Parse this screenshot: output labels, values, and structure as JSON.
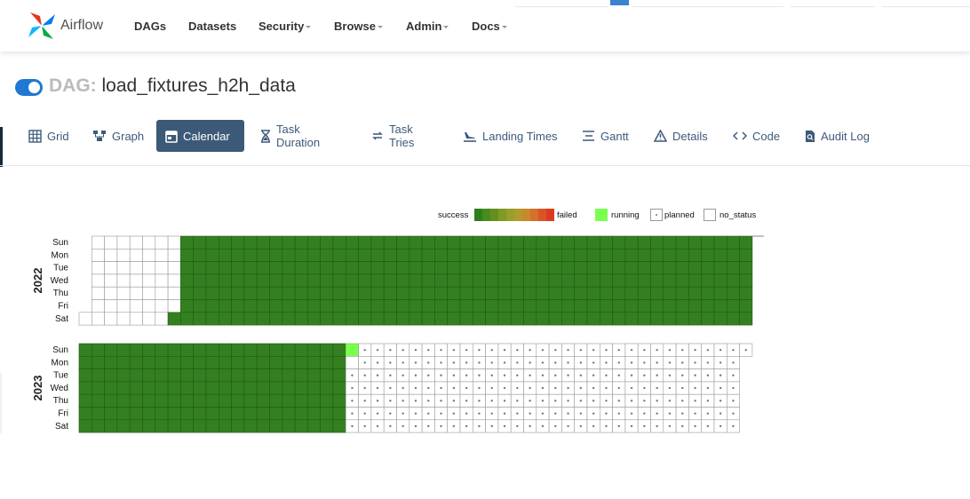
{
  "navbar": {
    "brand": "Airflow",
    "items": [
      {
        "label": "DAGs",
        "dropdown": false
      },
      {
        "label": "Datasets",
        "dropdown": false
      },
      {
        "label": "Security",
        "dropdown": true
      },
      {
        "label": "Browse",
        "dropdown": true
      },
      {
        "label": "Admin",
        "dropdown": true
      },
      {
        "label": "Docs",
        "dropdown": true
      }
    ]
  },
  "dag": {
    "label": "DAG:",
    "name": "load_fixtures_h2h_data",
    "enabled": true
  },
  "tabs": [
    {
      "label": "Grid",
      "icon": "grid-icon",
      "active": false
    },
    {
      "label": "Graph",
      "icon": "graph-icon",
      "active": false
    },
    {
      "label": "Calendar",
      "icon": "calendar-icon",
      "active": true
    },
    {
      "label": "Task Duration",
      "icon": "hourglass-icon",
      "active": false
    },
    {
      "label": "Task Tries",
      "icon": "retry-icon",
      "active": false
    },
    {
      "label": "Landing Times",
      "icon": "landing-icon",
      "active": false
    },
    {
      "label": "Gantt",
      "icon": "gantt-icon",
      "active": false
    },
    {
      "label": "Details",
      "icon": "warning-icon",
      "active": false
    },
    {
      "label": "Code",
      "icon": "code-icon",
      "active": false
    },
    {
      "label": "Audit Log",
      "icon": "audit-icon",
      "active": false
    }
  ],
  "legend": {
    "success": "success",
    "failed": "failed",
    "running": "running",
    "planned": "planned",
    "no_status": "no_status",
    "colors": {
      "success_gradient": [
        "#2e7d1f",
        "#4a8a1e",
        "#668f22",
        "#7f9a25",
        "#96a02a",
        "#b09a2d",
        "#c68a2c",
        "#d5702a",
        "#db5428",
        "#dd3a22"
      ],
      "running": "#7bff4f",
      "success": "#348021",
      "border": "#999999"
    }
  },
  "calendar": {
    "weekdays": [
      "Sun",
      "Mon",
      "Tue",
      "Wed",
      "Thu",
      "Fri",
      "Sat"
    ],
    "years": [
      {
        "year": "2022",
        "empty_until_week": 6,
        "success_from_week": 6,
        "weeks": 53
      },
      {
        "year": "2023",
        "success_weeks": 21,
        "running_cell": "Sun",
        "planned_weeks": 31
      }
    ]
  }
}
